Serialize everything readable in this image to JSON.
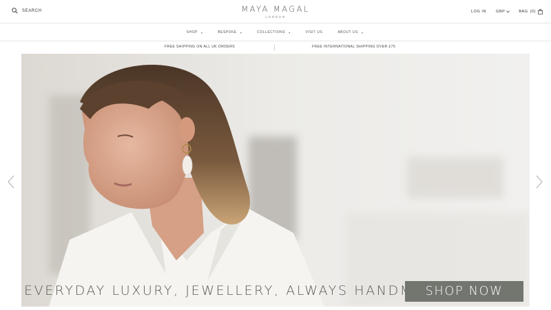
{
  "header": {
    "search_label": "SEARCH",
    "logo_main": "MAYA MAGAL",
    "logo_sub": "LONDON",
    "login_label": "LOG IN",
    "currency_label": "GBP",
    "bag_label": "BAG",
    "bag_count": "(0)"
  },
  "nav": {
    "items": [
      {
        "label": "SHOP",
        "has_dropdown": true
      },
      {
        "label": "BESPOKE",
        "has_dropdown": true
      },
      {
        "label": "COLLECTIONS",
        "has_dropdown": true
      },
      {
        "label": "VISIT US",
        "has_dropdown": false
      },
      {
        "label": "ABOUT US",
        "has_dropdown": true
      }
    ],
    "caret": "▾"
  },
  "promo": {
    "left": "FREE SHIPPING ON ALL UK ORDERS",
    "right": "FREE INTERNATIONAL SHIPPING OVER £75"
  },
  "hero": {
    "tagline": "EVERYDAY LUXURY, JEWELLERY, ALWAYS HANDMADE.",
    "cta_label": "SHOP NOW"
  },
  "icons": {
    "search": "search-icon",
    "currency_chevron": "chevron-down-icon",
    "bag": "bag-icon",
    "prev": "chevron-left-icon",
    "next": "chevron-right-icon"
  },
  "colors": {
    "cta_background": "#73756f",
    "tagline_text": "#5c5a56",
    "divider": "#e6e6e6"
  }
}
